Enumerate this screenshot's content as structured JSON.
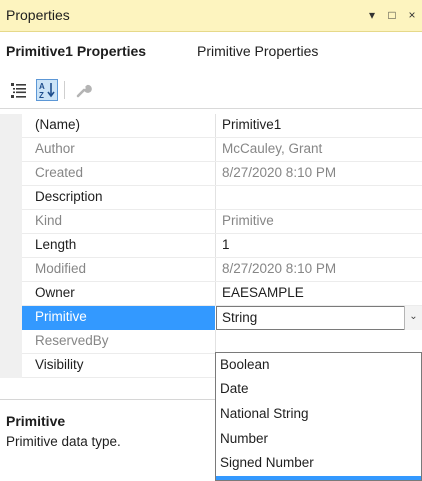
{
  "window": {
    "title": "Properties",
    "dropdown_glyph": "▾",
    "maximize_glyph": "□",
    "close_glyph": "×"
  },
  "header": {
    "object_name": "Primitive1 Properties",
    "object_kind": "Primitive Properties"
  },
  "toolbar": {
    "icons": [
      "categorized-icon",
      "alphabetical-icon",
      "property-pages-icon"
    ]
  },
  "properties": [
    {
      "name": "(Name)",
      "value": "Primitive1",
      "readonly": false
    },
    {
      "name": "Author",
      "value": "McCauley, Grant",
      "readonly": true
    },
    {
      "name": "Created",
      "value": "8/27/2020 8:10 PM",
      "readonly": true
    },
    {
      "name": "Description",
      "value": "",
      "readonly": false
    },
    {
      "name": "Kind",
      "value": "Primitive",
      "readonly": true
    },
    {
      "name": "Length",
      "value": "1",
      "readonly": false
    },
    {
      "name": "Modified",
      "value": "8/27/2020 8:10 PM",
      "readonly": true
    },
    {
      "name": "Owner",
      "value": "EAESAMPLE",
      "readonly": false
    },
    {
      "name": "Primitive",
      "value": "String",
      "readonly": false,
      "selected": true
    },
    {
      "name": "ReservedBy",
      "value": "",
      "readonly": true
    },
    {
      "name": "Visibility",
      "value": "",
      "readonly": false
    }
  ],
  "dropdown": {
    "options": [
      "Boolean",
      "Date",
      "National String",
      "Number",
      "Signed Number"
    ]
  },
  "description": {
    "title": "Primitive",
    "text": "Primitive data type."
  },
  "colors": {
    "titlebar_bg": "#fdf4bf",
    "selection": "#3399ff",
    "readonly_text": "#868686"
  }
}
